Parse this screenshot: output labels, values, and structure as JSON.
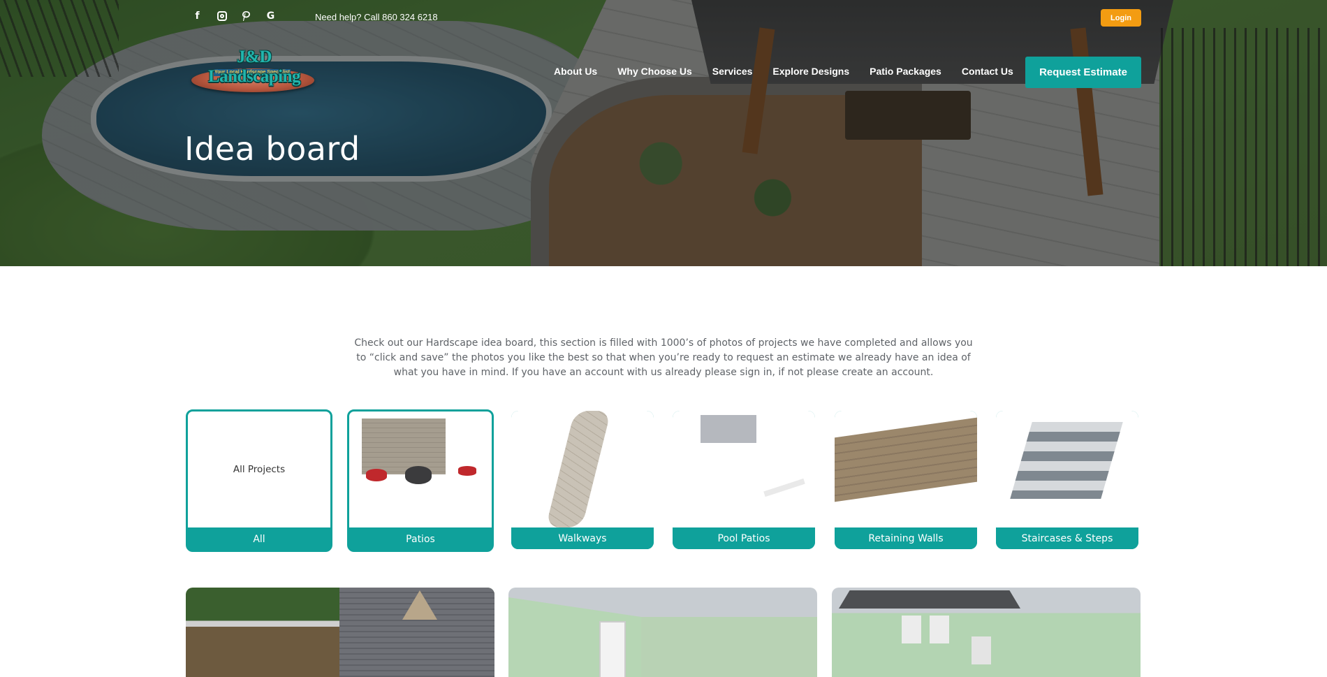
{
  "topbar": {
    "social_icons": [
      "facebook-icon",
      "instagram-icon",
      "pinterest-icon",
      "google-icon"
    ],
    "help_text": "Need help? Call 860 324 6218",
    "login_label": "Login"
  },
  "logo": {
    "name": "J&D Landscaping",
    "tagline": "Your Local Hardscape Specialist"
  },
  "nav": {
    "items": [
      "About Us",
      "Why Choose Us",
      "Services",
      "Explore Designs",
      "Patio Packages",
      "Contact Us"
    ],
    "cta_label": "Request Estimate"
  },
  "hero": {
    "title": "Idea board"
  },
  "intro": {
    "text": "Check out our Hardscape idea board, this section is filled with 1000’s of photos of projects we have completed and allows you to “click and save” the photos you like the best so that when you’re ready to request an estimate we already have an idea of what you have in mind. If you have an account with us already please sign in, if not please create an account."
  },
  "categories": {
    "all_thumb_text": "All Projects",
    "items": [
      {
        "label": "All",
        "selected": true
      },
      {
        "label": "Patios",
        "selected": true
      },
      {
        "label": "Walkways",
        "selected": false
      },
      {
        "label": "Pool Patios",
        "selected": false
      },
      {
        "label": "Retaining Walls",
        "selected": false
      },
      {
        "label": "Staircases & Steps",
        "selected": false
      }
    ]
  },
  "colors": {
    "accent": "#0fa19b",
    "login": "#f39c12",
    "intro_text": "#5f6368"
  }
}
